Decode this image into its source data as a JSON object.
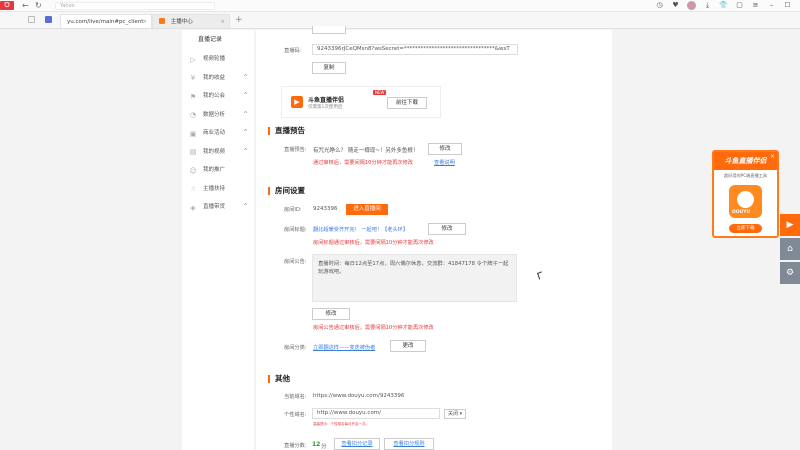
{
  "browser": {
    "logo_text": "ᗜ",
    "address_placeholder": "Yahoo",
    "tabs": [
      {
        "title": "yu.com/live/main#pc_client"
      },
      {
        "title": "主播中心"
      }
    ]
  },
  "sidebar": {
    "title": "直播记录",
    "items": [
      {
        "label": "视频轮播",
        "icon": "play-icon"
      },
      {
        "label": "我的收益",
        "icon": "coin-icon",
        "chevron": "^"
      },
      {
        "label": "我的公会",
        "icon": "guild-icon",
        "chevron": "^"
      },
      {
        "label": "数据分析",
        "icon": "chart-icon",
        "chevron": "^"
      },
      {
        "label": "商业活动",
        "icon": "shop-icon",
        "chevron": "^"
      },
      {
        "label": "我的视频",
        "icon": "video-icon",
        "chevron": "^"
      },
      {
        "label": "我的推广",
        "icon": "promote-icon"
      },
      {
        "label": "主播扶持",
        "icon": "thumb-icon"
      },
      {
        "label": "直播带货",
        "icon": "bag-icon",
        "chevron": "^"
      }
    ]
  },
  "stream": {
    "code_label": "直播码:",
    "code_value": "9243396rJCeQMsn8?wsSecret=*********************************&wsT",
    "copy_label": "复制"
  },
  "promo": {
    "name": "斗鱼直播伴侣",
    "desc": "仅需第1次使用后",
    "new_badge": "NEW",
    "download_label": "前往下载"
  },
  "preview": {
    "section_title": "直播预告",
    "label": "直播预告:",
    "value": "有咒光睁么？ 随走一樽现~！另外多鱼根！",
    "modify_label": "修改",
    "note": "通过审核后，需要间隔10分钟才能再次修改",
    "link": "查看说明"
  },
  "room": {
    "section_title": "房间设置",
    "id_label": "房间ID:",
    "id_value": "9243396",
    "enter_label": "进入直播间",
    "title_label": "房间标题:",
    "title_value": "翻比超暖受齐开完！ 一起吧！【老头环】",
    "title_modify": "修改",
    "title_note": "房间标题通过审核后，需要间隔10分钟才能再次修改",
    "notice_label": "房间公告:",
    "notice_text": "直播时间：每日12点至17点，周六偶尔休息，交流群：41847178 令个牌子一起玩游戏吧。",
    "notice_modify": "修改",
    "notice_note": "房间公告通过审核后，需要间隔10分钟才能再次修改",
    "category_label": "房间分类:",
    "category_value": "立即翻这样——变迭被伪者",
    "category_change": "更改"
  },
  "other": {
    "section_title": "其他",
    "domain_label": "当前域名:",
    "domain_value": "https://www.douyu.com/9243396",
    "custom_label": "个性域名:",
    "custom_value": "http://www.douyu.com/",
    "custom_select": "关闭",
    "custom_note": "温馨提示：个性域名每月开启一次。",
    "score_label": "直播分数:",
    "score_value": "12",
    "score_unit": "分",
    "score_link1": "查看扣分记录",
    "score_link2": "查看扣分规则"
  },
  "float_ad": {
    "title": "斗鱼直播伴侣",
    "subtitle": "超好用的PC端直播工具",
    "brand": "DOUYU",
    "download_label": "立即下载"
  },
  "side_tools": {
    "items": [
      "▶",
      "⌂",
      "⚙"
    ]
  }
}
